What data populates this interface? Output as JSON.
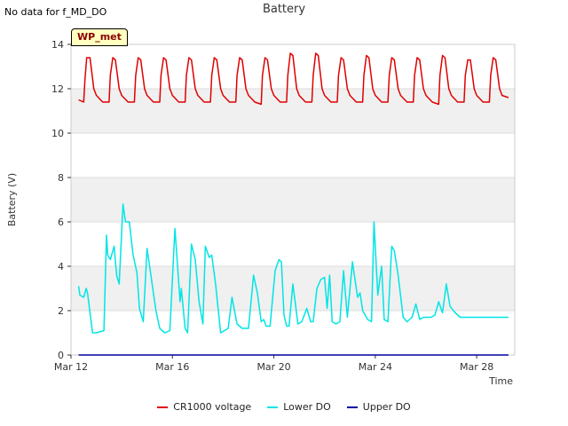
{
  "header": {
    "no_data_text": "No data for f_MD_DO",
    "site_tag": "WP_met"
  },
  "chart_data": {
    "type": "line",
    "title": "Battery",
    "xlabel": "Time",
    "ylabel": "Battery (V)",
    "xlim": [
      0,
      17.5
    ],
    "ylim": [
      0,
      14
    ],
    "x_ticks": [
      {
        "x": 0,
        "label": "Mar 12"
      },
      {
        "x": 4,
        "label": "Mar 16"
      },
      {
        "x": 8,
        "label": "Mar 20"
      },
      {
        "x": 12,
        "label": "Mar 24"
      },
      {
        "x": 16,
        "label": "Mar 28"
      }
    ],
    "y_ticks": [
      0,
      2,
      4,
      6,
      8,
      10,
      12,
      14
    ],
    "grid": true,
    "background_bands": "alternating horizontal bands",
    "legend_position": "bottom",
    "series": [
      {
        "name": "CR1000 voltage",
        "color": "#e00000",
        "x": [
          0.3,
          0.5,
          0.55,
          0.62,
          0.75,
          0.9,
          1.0,
          1.25,
          1.5,
          1.55,
          1.65,
          1.75,
          1.9,
          2.0,
          2.25,
          2.5,
          2.55,
          2.65,
          2.75,
          2.9,
          3.0,
          3.25,
          3.5,
          3.55,
          3.65,
          3.75,
          3.9,
          4.0,
          4.25,
          4.5,
          4.55,
          4.65,
          4.75,
          4.9,
          5.0,
          5.25,
          5.5,
          5.55,
          5.65,
          5.75,
          5.9,
          6.0,
          6.25,
          6.5,
          6.55,
          6.65,
          6.75,
          6.9,
          7.0,
          7.25,
          7.5,
          7.55,
          7.65,
          7.75,
          7.9,
          8.0,
          8.25,
          8.5,
          8.55,
          8.65,
          8.75,
          8.9,
          9.0,
          9.25,
          9.5,
          9.55,
          9.65,
          9.75,
          9.9,
          10.0,
          10.25,
          10.5,
          10.55,
          10.65,
          10.75,
          10.9,
          11.0,
          11.25,
          11.5,
          11.55,
          11.65,
          11.75,
          11.9,
          12.0,
          12.25,
          12.5,
          12.55,
          12.65,
          12.75,
          12.9,
          13.0,
          13.25,
          13.5,
          13.55,
          13.65,
          13.75,
          13.9,
          14.0,
          14.25,
          14.5,
          14.55,
          14.65,
          14.75,
          14.9,
          15.0,
          15.25,
          15.5,
          15.55,
          15.65,
          15.75,
          15.9,
          16.0,
          16.25,
          16.5,
          16.55,
          16.65,
          16.75,
          16.9,
          17.0,
          17.25
        ],
        "y": [
          11.5,
          11.4,
          12.4,
          13.4,
          13.4,
          12.0,
          11.7,
          11.4,
          11.4,
          12.6,
          13.4,
          13.3,
          12.0,
          11.7,
          11.4,
          11.4,
          12.6,
          13.4,
          13.3,
          12.0,
          11.7,
          11.4,
          11.4,
          12.6,
          13.4,
          13.3,
          12.0,
          11.7,
          11.4,
          11.4,
          12.6,
          13.4,
          13.3,
          12.0,
          11.7,
          11.4,
          11.4,
          12.6,
          13.4,
          13.3,
          12.0,
          11.7,
          11.4,
          11.4,
          12.6,
          13.4,
          13.3,
          12.0,
          11.7,
          11.4,
          11.3,
          12.6,
          13.4,
          13.3,
          12.0,
          11.7,
          11.4,
          11.4,
          12.6,
          13.6,
          13.5,
          12.0,
          11.7,
          11.4,
          11.4,
          12.6,
          13.6,
          13.5,
          12.0,
          11.7,
          11.4,
          11.4,
          12.6,
          13.4,
          13.3,
          12.0,
          11.7,
          11.4,
          11.4,
          12.6,
          13.5,
          13.4,
          12.0,
          11.7,
          11.4,
          11.4,
          12.6,
          13.4,
          13.3,
          12.0,
          11.7,
          11.4,
          11.4,
          12.6,
          13.4,
          13.3,
          12.0,
          11.7,
          11.4,
          11.3,
          12.6,
          13.5,
          13.4,
          12.0,
          11.7,
          11.4,
          11.4,
          12.6,
          13.3,
          13.3,
          12.0,
          11.7,
          11.4,
          11.4,
          12.6,
          13.4,
          13.3,
          12.0,
          11.7,
          11.6
        ]
      },
      {
        "name": "Lower DO",
        "color": "#00e5e5",
        "x": [
          0.3,
          0.35,
          0.5,
          0.6,
          0.65,
          0.85,
          1.0,
          1.3,
          1.4,
          1.45,
          1.55,
          1.7,
          1.8,
          1.9,
          2.05,
          2.15,
          2.3,
          2.45,
          2.6,
          2.7,
          2.85,
          3.0,
          3.15,
          3.35,
          3.5,
          3.7,
          3.9,
          4.1,
          4.3,
          4.35,
          4.5,
          4.6,
          4.75,
          4.9,
          5.05,
          5.2,
          5.3,
          5.45,
          5.55,
          5.7,
          5.9,
          6.05,
          6.2,
          6.35,
          6.55,
          6.75,
          6.85,
          7.0,
          7.2,
          7.35,
          7.5,
          7.6,
          7.7,
          7.85,
          8.05,
          8.2,
          8.3,
          8.4,
          8.5,
          8.6,
          8.75,
          8.95,
          9.1,
          9.3,
          9.45,
          9.55,
          9.7,
          9.85,
          10.0,
          10.1,
          10.2,
          10.3,
          10.45,
          10.6,
          10.75,
          10.9,
          11.1,
          11.3,
          11.4,
          11.5,
          11.7,
          11.85,
          11.95,
          12.1,
          12.25,
          12.35,
          12.5,
          12.65,
          12.75,
          12.9,
          13.1,
          13.25,
          13.35,
          13.45,
          13.6,
          13.75,
          13.9,
          14.05,
          14.2,
          14.35,
          14.5,
          14.65,
          14.8,
          14.95,
          15.15,
          15.35,
          15.55,
          15.75,
          15.95,
          16.1,
          16.25,
          16.35,
          16.45,
          16.6,
          16.75,
          16.9,
          17.05,
          17.25
        ],
        "y": [
          3.1,
          2.7,
          2.6,
          3.0,
          2.8,
          1.0,
          1.0,
          1.1,
          5.4,
          4.5,
          4.3,
          4.9,
          3.6,
          3.2,
          6.8,
          6.0,
          6.0,
          4.5,
          3.7,
          2.1,
          1.5,
          4.8,
          3.6,
          2.0,
          1.2,
          1.0,
          1.1,
          5.7,
          2.4,
          3.0,
          1.2,
          1.0,
          5.0,
          4.3,
          2.4,
          1.4,
          4.9,
          4.4,
          4.5,
          3.2,
          1.0,
          1.1,
          1.2,
          2.6,
          1.4,
          1.2,
          1.2,
          1.2,
          3.6,
          2.8,
          1.5,
          1.6,
          1.3,
          1.3,
          3.8,
          4.3,
          4.2,
          1.8,
          1.3,
          1.3,
          3.2,
          1.4,
          1.5,
          2.1,
          1.5,
          1.5,
          3.0,
          3.4,
          3.5,
          2.1,
          3.6,
          1.5,
          1.4,
          1.5,
          3.8,
          1.7,
          4.2,
          2.6,
          2.8,
          2.0,
          1.6,
          1.5,
          6.0,
          2.7,
          4.0,
          1.6,
          1.5,
          4.9,
          4.7,
          3.6,
          1.7,
          1.5,
          1.6,
          1.7,
          2.3,
          1.6,
          1.7,
          1.7,
          1.7,
          1.8,
          2.4,
          1.9,
          3.2,
          2.2,
          1.9,
          1.7,
          1.7,
          1.7,
          1.7,
          1.7,
          1.7,
          1.7,
          1.7,
          1.7,
          1.7,
          1.7,
          1.7,
          1.7
        ]
      },
      {
        "name": "Upper DO",
        "color": "#0000a0",
        "x": [
          0.3,
          17.25
        ],
        "y": [
          0.0,
          0.0
        ]
      }
    ]
  }
}
